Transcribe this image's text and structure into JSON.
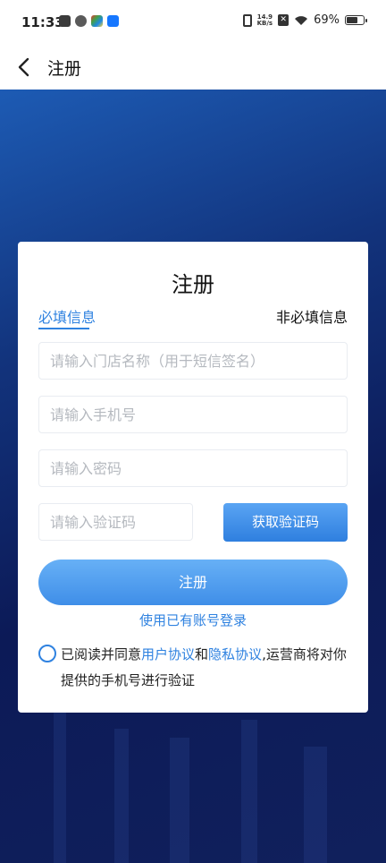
{
  "status_bar": {
    "time": "11:33",
    "net_speed_value": "14.9",
    "net_speed_unit": "KB/s",
    "battery_percent": "69%",
    "battery_level": 0.69,
    "icons": [
      "app-notification-icon",
      "app-sync-icon",
      "app-color-icon",
      "alipay-icon",
      "vibrate-icon",
      "sim-x-icon",
      "wifi-icon",
      "battery-icon"
    ]
  },
  "nav": {
    "back_icon": "chevron-left-icon",
    "title": "注册"
  },
  "card": {
    "title": "注册",
    "tabs": {
      "required": "必填信息",
      "optional": "非必填信息"
    },
    "fields": {
      "store_name_placeholder": "请输入门店名称（用于短信签名）",
      "phone_placeholder": "请输入手机号",
      "password_placeholder": "请输入密码",
      "code_placeholder": "请输入验证码"
    },
    "get_code_label": "获取验证码",
    "submit_label": "注册",
    "login_link": "使用已有账号登录",
    "agreement": {
      "prefix": "已阅读并同意",
      "user_agreement": "用户协议",
      "and": "和",
      "privacy_agreement": "隐私协议",
      "suffix": ",运营商将对你提供的手机号进行验证"
    }
  },
  "colors": {
    "accent": "#2f82e0",
    "background_dark": "#0c1a57",
    "background_light": "#1d5bb4"
  }
}
